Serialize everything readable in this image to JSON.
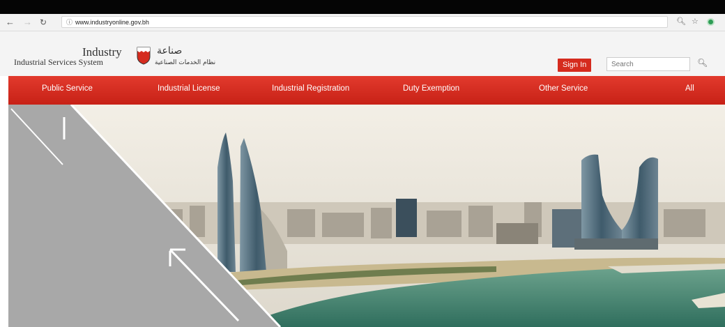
{
  "browser": {
    "back_icon": "back-arrow-icon",
    "forward_icon": "forward-arrow-icon",
    "reload_icon": "reload-icon",
    "url": "www.industryonline.gov.bh"
  },
  "header": {
    "title_en_line1": "Industry",
    "title_en_line2": "Industrial Services System",
    "title_ar_line1": "صناعة",
    "title_ar_line2": "نظام الخدمات الصناعية",
    "sign_in_label": "Sign In",
    "search_placeholder": "Search"
  },
  "nav": {
    "items": [
      {
        "label": "Public Service"
      },
      {
        "label": "Industrial License"
      },
      {
        "label": "Industrial Registration"
      },
      {
        "label": "Duty Exemption"
      },
      {
        "label": "Other Service"
      },
      {
        "label": "All"
      }
    ]
  },
  "colors": {
    "nav_red": "#d52b1e",
    "panel_gray": "#a8a8a8"
  }
}
